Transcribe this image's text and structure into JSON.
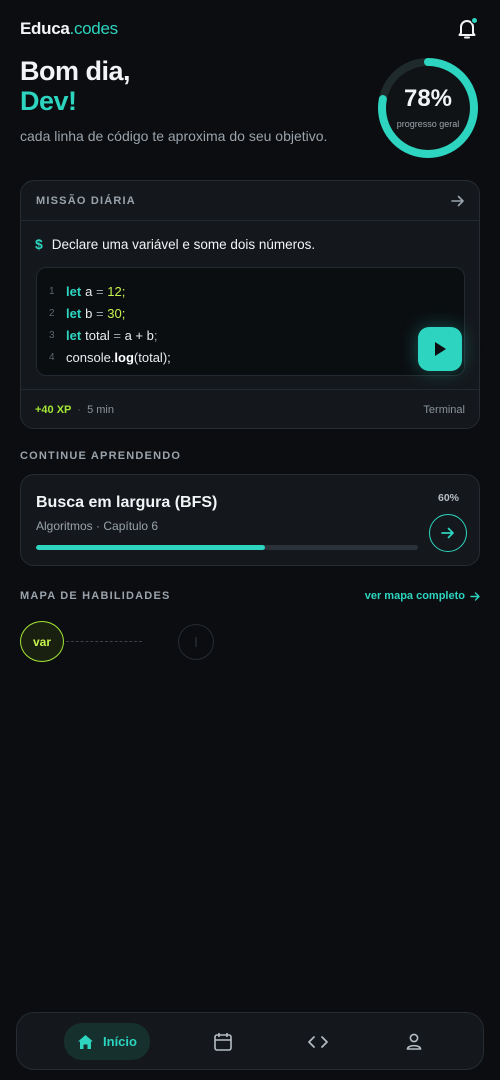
{
  "header": {
    "brand_a": "Educa",
    "brand_b": ".codes",
    "has_notification": true
  },
  "greeting": {
    "line1": "Bom dia,",
    "name": "Dev!",
    "subtitle": "cada linha de código te aproxima do seu objetivo."
  },
  "progress": {
    "value": 0.78,
    "percent_label": "78%",
    "label": "progresso geral"
  },
  "mission": {
    "section_label": "MISSÃO DIÁRIA",
    "task": "Declare uma variável e some dois números.",
    "code_lines": [
      {
        "n": "1",
        "kw": "let",
        "name": "a",
        "op": "=",
        "val": "12",
        "end": ";"
      },
      {
        "n": "2",
        "kw": "let",
        "name": "b",
        "op": "=",
        "val": "30",
        "end": ";"
      },
      {
        "n": "3",
        "kw": "let",
        "name": "total",
        "op": "=",
        "expr": "a + b",
        "end": ";"
      },
      {
        "n": "4",
        "obj": "console.",
        "fn": "log",
        "args": "(total);"
      }
    ],
    "xp": "+40 XP",
    "dot": "·",
    "duration": "5 min",
    "mode": "Terminal"
  },
  "continue": {
    "section_label": "CONTINUE APRENDENDO",
    "course_title": "Busca em largura (BFS)",
    "course_sub": "Algoritmos · Capítulo 6",
    "percent_label": "60%",
    "progress": 0.6
  },
  "skills": {
    "section_label": "MAPA DE HABILIDADES",
    "link": "ver mapa completo",
    "node_label": "var"
  },
  "nav": {
    "home_label": "Início"
  },
  "colors": {
    "accent": "#2dd4bf",
    "lime": "#a3e635",
    "bg": "#0b0d10",
    "card": "#14181c"
  }
}
